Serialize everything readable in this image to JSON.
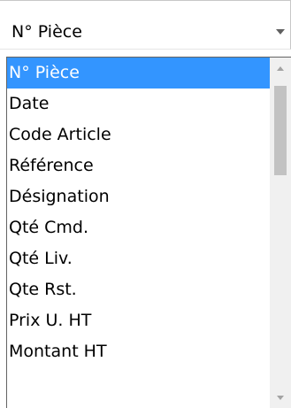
{
  "select": {
    "value": "N° Pièce"
  },
  "dropdown": {
    "options": [
      "N° Pièce",
      "Date",
      "Code Article",
      "Référence",
      "Désignation",
      "Qté Cmd.",
      "Qté Liv.",
      "Qte Rst.",
      "Prix U. HT",
      "Montant HT"
    ],
    "selected_index": 0
  },
  "colors": {
    "selection": "#3395ff",
    "border": "#646464",
    "scrollbar_thumb": "#c2c2c2"
  },
  "icons": {
    "dropdown_toggle": "chevron-down-icon",
    "scroll_up": "scroll-up-arrow-icon",
    "scroll_down": "scroll-down-arrow-icon"
  }
}
